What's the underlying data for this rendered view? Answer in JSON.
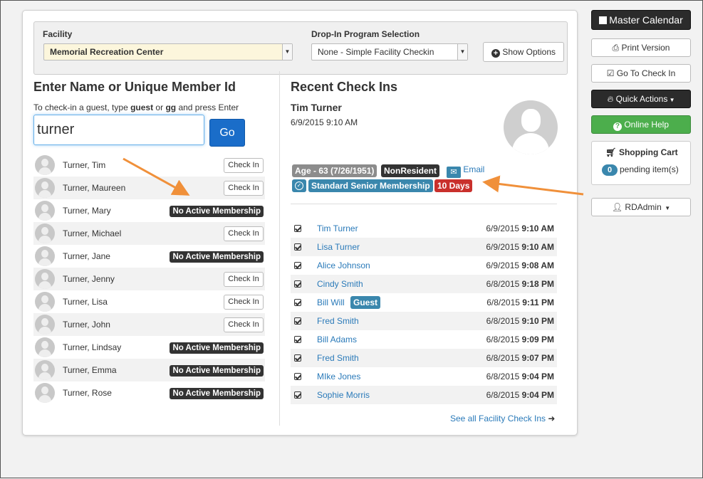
{
  "filters": {
    "facility_label": "Facility",
    "facility_value": "Memorial Recreation Center",
    "program_label": "Drop-In Program Selection",
    "program_value": "None - Simple Facility Checkin",
    "show_options": "Show Options"
  },
  "search": {
    "title": "Enter Name or Unique Member Id",
    "hint_pre": "To check-in a guest, type ",
    "hint_guest": "guest",
    "hint_or": " or ",
    "hint_gg": "gg",
    "hint_post": " and press Enter",
    "value": "turner",
    "go_label": "Go"
  },
  "members": [
    {
      "name": "Turner, Tim",
      "status": "Check In"
    },
    {
      "name": "Turner, Maureen",
      "status": "Check In"
    },
    {
      "name": "Turner, Mary",
      "status": "No Active Membership"
    },
    {
      "name": "Turner, Michael",
      "status": "Check In"
    },
    {
      "name": "Turner, Jane",
      "status": "No Active Membership"
    },
    {
      "name": "Turner, Jenny",
      "status": "Check In"
    },
    {
      "name": "Turner, Lisa",
      "status": "Check In"
    },
    {
      "name": "Turner, John",
      "status": "Check In"
    },
    {
      "name": "Turner, Lindsay",
      "status": "No Active Membership"
    },
    {
      "name": "Turner, Emma",
      "status": "No Active Membership"
    },
    {
      "name": "Turner, Rose",
      "status": "No Active Membership"
    }
  ],
  "recent": {
    "title": "Recent Check Ins",
    "selected_name": "Tim Turner",
    "selected_time": "6/9/2015  9:10 AM",
    "tag_age": "Age - 63 (7/26/1951)",
    "tag_resident": "NonResident",
    "email_label": "Email",
    "tag_membership": "Standard Senior Membership",
    "tag_days": "10 Days",
    "see_all": "See all Facility Check Ins",
    "checkins": [
      {
        "name": "Tim Turner",
        "date": "6/9/2015",
        "time": "9:10 AM",
        "guest": ""
      },
      {
        "name": "Lisa Turner",
        "date": "6/9/2015",
        "time": "9:10 AM",
        "guest": ""
      },
      {
        "name": "Alice Johnson",
        "date": "6/9/2015",
        "time": "9:08 AM",
        "guest": ""
      },
      {
        "name": "Cindy Smith",
        "date": "6/8/2015",
        "time": "9:18 PM",
        "guest": ""
      },
      {
        "name": "Bill Will",
        "date": "6/8/2015",
        "time": "9:11 PM",
        "guest": "Guest"
      },
      {
        "name": "Fred Smith",
        "date": "6/8/2015",
        "time": "9:10 PM",
        "guest": ""
      },
      {
        "name": "Bill Adams",
        "date": "6/8/2015",
        "time": "9:09 PM",
        "guest": ""
      },
      {
        "name": "Fred Smith",
        "date": "6/8/2015",
        "time": "9:07 PM",
        "guest": ""
      },
      {
        "name": "MIke Jones",
        "date": "6/8/2015",
        "time": "9:04 PM",
        "guest": ""
      },
      {
        "name": "Sophie Morris",
        "date": "6/8/2015",
        "time": "9:04 PM",
        "guest": ""
      }
    ]
  },
  "sidebar": {
    "master_calendar": "Master Calendar",
    "print_version": "Print Version",
    "go_to_check_in": "Go To Check In",
    "quick_actions": "Quick Actions",
    "online_help": "Online Help",
    "cart_title": "Shopping Cart",
    "cart_count": "0",
    "cart_pending": "pending item(s)",
    "user": "RDAdmin"
  },
  "colors": {
    "link": "#2a7ab9",
    "primary_button": "#1a6dc9",
    "tag_gray": "#8c8c8c",
    "tag_dark": "#333333",
    "tag_blue": "#3a87ad",
    "tag_red": "#c9302c",
    "help_green": "#4cae4c",
    "annotation_arrow": "#f0903a"
  }
}
